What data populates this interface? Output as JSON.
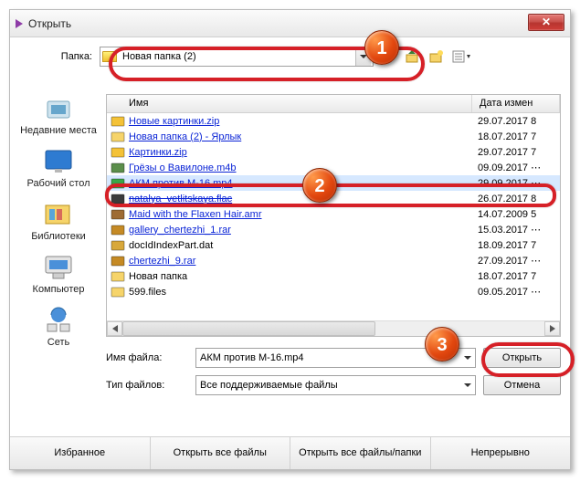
{
  "title": "Открыть",
  "folder_label": "Папка:",
  "folder_value": "Новая папка (2)",
  "columns": {
    "name": "Имя",
    "date": "Дата измен"
  },
  "files": [
    {
      "icon": "zip",
      "name": "Новые картинки.zip",
      "date": "29.07.2017 8",
      "link": true
    },
    {
      "icon": "folder",
      "name": "Новая папка (2) - Ярлык",
      "date": "18.07.2017 7",
      "link": true
    },
    {
      "icon": "zip",
      "name": "Картинки.zip",
      "date": "29.07.2017 7",
      "link": true
    },
    {
      "icon": "m4b",
      "name": "Грёзы о Вавилоне.m4b",
      "date": "09.09.2017 ⋯",
      "link": true,
      "cut": true
    },
    {
      "icon": "mp4",
      "name": "АКМ против М-16.mp4",
      "date": "29.09.2017 ⋯",
      "link": true,
      "selected": true
    },
    {
      "icon": "flac",
      "name": "natalya_vetlitskaya.flac",
      "date": "26.07.2017 8",
      "link": true,
      "strike": true
    },
    {
      "icon": "amr",
      "name": "Maid with the Flaxen Hair.amr",
      "date": "14.07.2009 5",
      "link": true
    },
    {
      "icon": "rar",
      "name": "gallery_chertezhi_1.rar",
      "date": "15.03.2017 ⋯",
      "link": true
    },
    {
      "icon": "dat",
      "name": "docIdIndexPart.dat",
      "date": "18.09.2017 7",
      "link": false
    },
    {
      "icon": "rar",
      "name": "chertezhi_9.rar",
      "date": "27.09.2017 ⋯",
      "link": true
    },
    {
      "icon": "folder",
      "name": "Новая папка",
      "date": "18.07.2017 7",
      "link": false
    },
    {
      "icon": "folder",
      "name": "599.files",
      "date": "09.05.2017 ⋯",
      "link": false
    }
  ],
  "places": [
    "Недавние места",
    "Рабочий стол",
    "Библиотеки",
    "Компьютер",
    "Сеть"
  ],
  "filename_label": "Имя файла:",
  "filename_value": "АКМ против М-16.mp4",
  "filetype_label": "Тип файлов:",
  "filetype_value": "Все поддерживаемые файлы",
  "open_btn": "Открыть",
  "cancel_btn": "Отмена",
  "bottom_buttons": [
    "Избранное",
    "Открыть все файлы",
    "Открыть все файлы/папки",
    "Непрерывно"
  ],
  "badges": {
    "b1": "1",
    "b2": "2",
    "b3": "3"
  },
  "icon_colors": {
    "zip": "#f4c237",
    "folder": "#f6d46a",
    "m4b": "#5b8e4b",
    "mp4": "#3aa84a",
    "flac": "#3c3c3c",
    "amr": "#9e6b34",
    "rar": "#c58a25",
    "dat": "#d8a83b"
  }
}
